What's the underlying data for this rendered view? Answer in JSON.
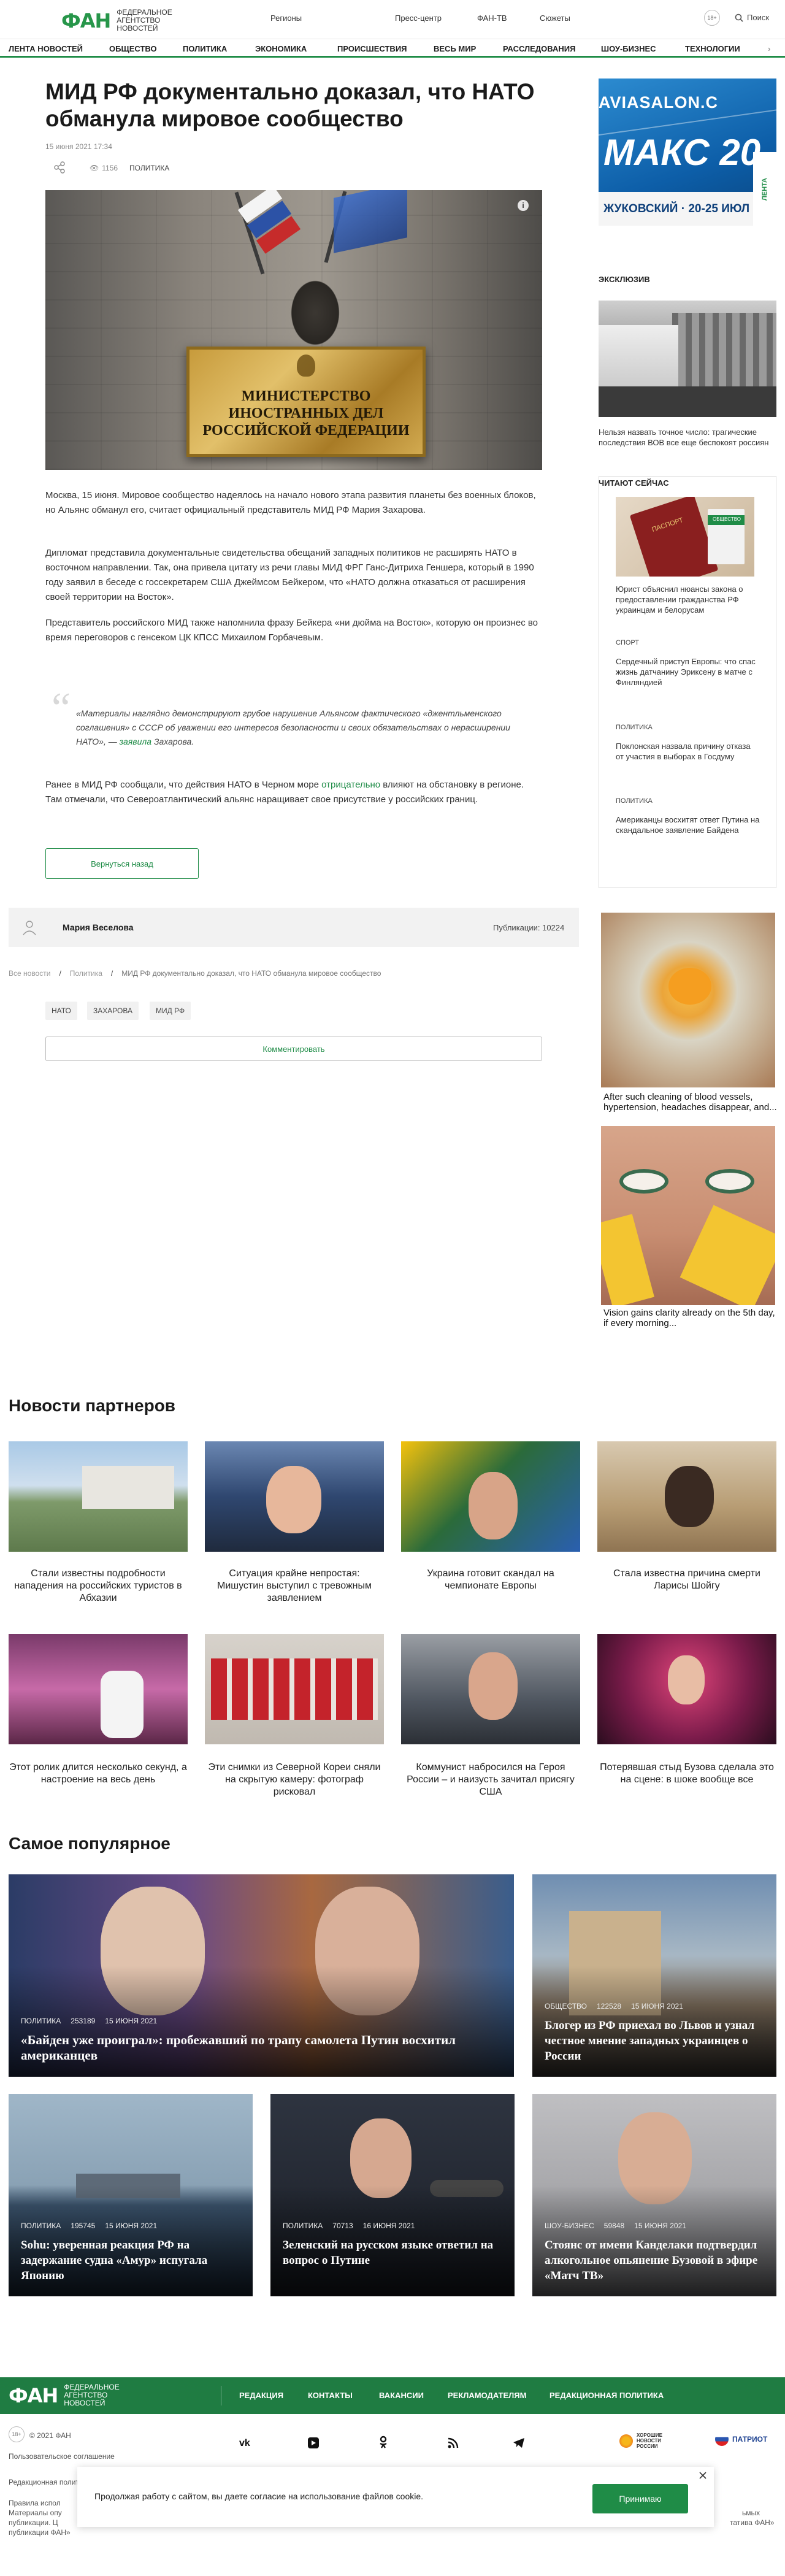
{
  "header": {
    "logo_mark": "ФАН",
    "logo_sub": "Федеральное агентство новостей",
    "nav": [
      "Регионы",
      "Пресс-центр",
      "ФАН-ТВ",
      "Сюжеты"
    ],
    "age": "18+",
    "search": "Поиск"
  },
  "categories": [
    "ЛЕНТА НОВОСТЕЙ",
    "ОБЩЕСТВО",
    "ПОЛИТИКА",
    "ЭКОНОМИКА",
    "ПРОИСШЕСТВИЯ",
    "ВЕСЬ МИР",
    "РАССЛЕДОВАНИЯ",
    "ШОУ-БИЗНЕС",
    "ТЕХНОЛОГИИ"
  ],
  "article": {
    "title": "МИД РФ документально доказал, что НАТО обманула мировое сообщество",
    "date": "15 июня 2021 17:34",
    "views": "1156",
    "rubric": "ПОЛИТИКА",
    "sign_lines": [
      "МИНИСТЕРСТВО",
      "ИНОСТРАННЫХ ДЕЛ",
      "РОССИЙСКОЙ ФЕДЕРАЦИИ"
    ],
    "p1": "Москва, 15 июня. Мировое сообщество надеялось на начало нового этапа развития планеты без военных блоков, но Альянс обманул его, считает официальный представитель МИД РФ Мария Захарова.",
    "p2": "Дипломат представила документальные свидетельства обещаний западных политиков не расширять НАТО в восточном направлении. Так, она привела цитату из речи главы МИД ФРГ Ганс-Дитриха Геншера, который в 1990 году заявил в беседе с госсекретарем США Джеймсом Бейкером, что «НАТО должна отказаться от расширения своей территории на Восток».",
    "p3": "Представитель российского МИД также напомнила фразу Бейкера «ни дюйма на Восток», которую он произнес во время переговоров с генсеком ЦК КПСС Михаилом Горбачевым.",
    "quote": "«Материалы наглядно демонстрируют грубое нарушение Альянсом фактического «джентльменского соглашения» с СССР об уважении его интересов безопасности и своих обязательствах о нерасширении НАТО», —",
    "quote_link": "заявила",
    "quote_end": "Захарова.",
    "p4_a": "Ранее в МИД РФ сообщали, что действия НАТО в Черном море",
    "p4_link": "отрицательно",
    "p4_b": "влияют на обстановку в регионе. Там отмечали, что Североатлантический альянс наращивает свое присутствие у российских границ.",
    "back_button": "Вернуться назад",
    "author": "Мария Веселова",
    "author_pubs": "Публикации: 10224",
    "breadcrumb": [
      "Все новости",
      "Политика",
      "МИД РФ документально доказал, что НАТО обманула мировое сообщество"
    ],
    "tags": [
      "НАТО",
      "ЗАХАРОВА",
      "МИД РФ"
    ],
    "comment_button": "Комментировать"
  },
  "sidebar": {
    "banner_site": "AVIASALON.C",
    "banner_brand": "МАКС 20",
    "banner_city": "ЖУКОВСКИЙ · 20-25 ИЮЛ",
    "feed_tab": "ЛЕНТА",
    "exclusive_label": "ЭКСКЛЮЗИВ",
    "exclusive_text": "Нельзя назвать точное число: трагические последствия ВОВ все еще беспокоят россиян",
    "reading_label": "ЧИТАЮТ СЕЙЧАС",
    "passport_text": "ПАСПОРТ",
    "reading_tag": "ОБЩЕСТВО",
    "reading_items": [
      {
        "rubric": "",
        "text": "Юрист объяснил нюансы закона о предоставлении гражданства РФ украинцам и белорусам"
      },
      {
        "rubric": "СПОРТ",
        "text": "Сердечный приступ Европы: что спас жизнь датчанину Эриксену в матче с Финляндией"
      },
      {
        "rubric": "ПОЛИТИКА",
        "text": "Поклонская назвала причину отказа от участия в выборах в Госдуму"
      },
      {
        "rubric": "ПОЛИТИКА",
        "text": "Американцы восхитят ответ Путина на скандальное заявление Байдена"
      }
    ],
    "ads": [
      "After such cleaning of blood vessels, hypertension, headaches disappear, and...",
      "Vision gains clarity already on the 5th day, if every morning..."
    ]
  },
  "partners": {
    "title": "Новости партнеров",
    "items": [
      "Стали известны подробности нападения на российских туристов в Абхазии",
      "Ситуация крайне непростая: Мишустин выступил с тревожным заявлением",
      "Украина готовит скандал на чемпионате Европы",
      "Стала известна причина смерти Ларисы Шойгу",
      "Этот ролик длится несколько секунд, а настроение на весь день",
      "Эти снимки из Северной Кореи сняли на скрытую камеру: фотограф рисковал",
      "Коммунист набросился на Героя России – и наизусть зачитал присягу США",
      "Потерявшая стыд Бузова сделала это на сцене: в шоке вообще все"
    ]
  },
  "popular": {
    "title": "Самое популярное",
    "items": [
      {
        "rubric": "ПОЛИТИКА",
        "views": "253189",
        "date": "15 ИЮНЯ 2021",
        "title": "«Байден уже проиграл»: пробежавший по трапу самолета Путин восхитил американцев"
      },
      {
        "rubric": "ОБЩЕСТВО",
        "views": "122528",
        "date": "15 ИЮНЯ 2021",
        "title": "Блогер из РФ приехал во Львов и узнал честное мнение западных украинцев о России"
      },
      {
        "rubric": "ПОЛИТИКА",
        "views": "195745",
        "date": "15 ИЮНЯ 2021",
        "title": "Sohu: уверенная реакция РФ на задержание судна «Амур» испугала Японию"
      },
      {
        "rubric": "ПОЛИТИКА",
        "views": "70713",
        "date": "16 ИЮНЯ 2021",
        "title": "Зеленский на русском языке ответил на вопрос о Путине"
      },
      {
        "rubric": "ШОУ-БИЗНЕС",
        "views": "59848",
        "date": "15 ИЮНЯ 2021",
        "title": "Стоянс от имени Канделаки подтвердил алкогольное опьянение Бузовой в эфире «Матч ТВ»"
      }
    ]
  },
  "footer": {
    "links": [
      "РЕДАКЦИЯ",
      "КОНТАКТЫ",
      "ВАКАНСИИ",
      "РЕКЛАМОДАТЕЛЯМ",
      "РЕДАКЦИОННАЯ ПОЛИТИКА"
    ],
    "age": "18+",
    "copyright": "© 2021 ФАН",
    "agreement": "Пользовательское соглашение",
    "policy": "Редакционная политика",
    "rules_start": "Правила испол",
    "materials_start": "Материалы опу",
    "publish_start": "публикации. Ц",
    "publish_end": "публикации ФАН»",
    "right_a": "ьмых",
    "right_b": "татива ФАН»",
    "partner1": "ХОРОШИЕ НОВОСТИ РОССИИ",
    "partner2": "ПАТРИОТ"
  },
  "cookie": {
    "text": "Продолжая работу с сайтом, вы даете согласие на использование файлов cookie.",
    "accept": "Принимаю"
  },
  "colors": {
    "brand": "#1f8c47",
    "footer": "#1f7c42"
  }
}
